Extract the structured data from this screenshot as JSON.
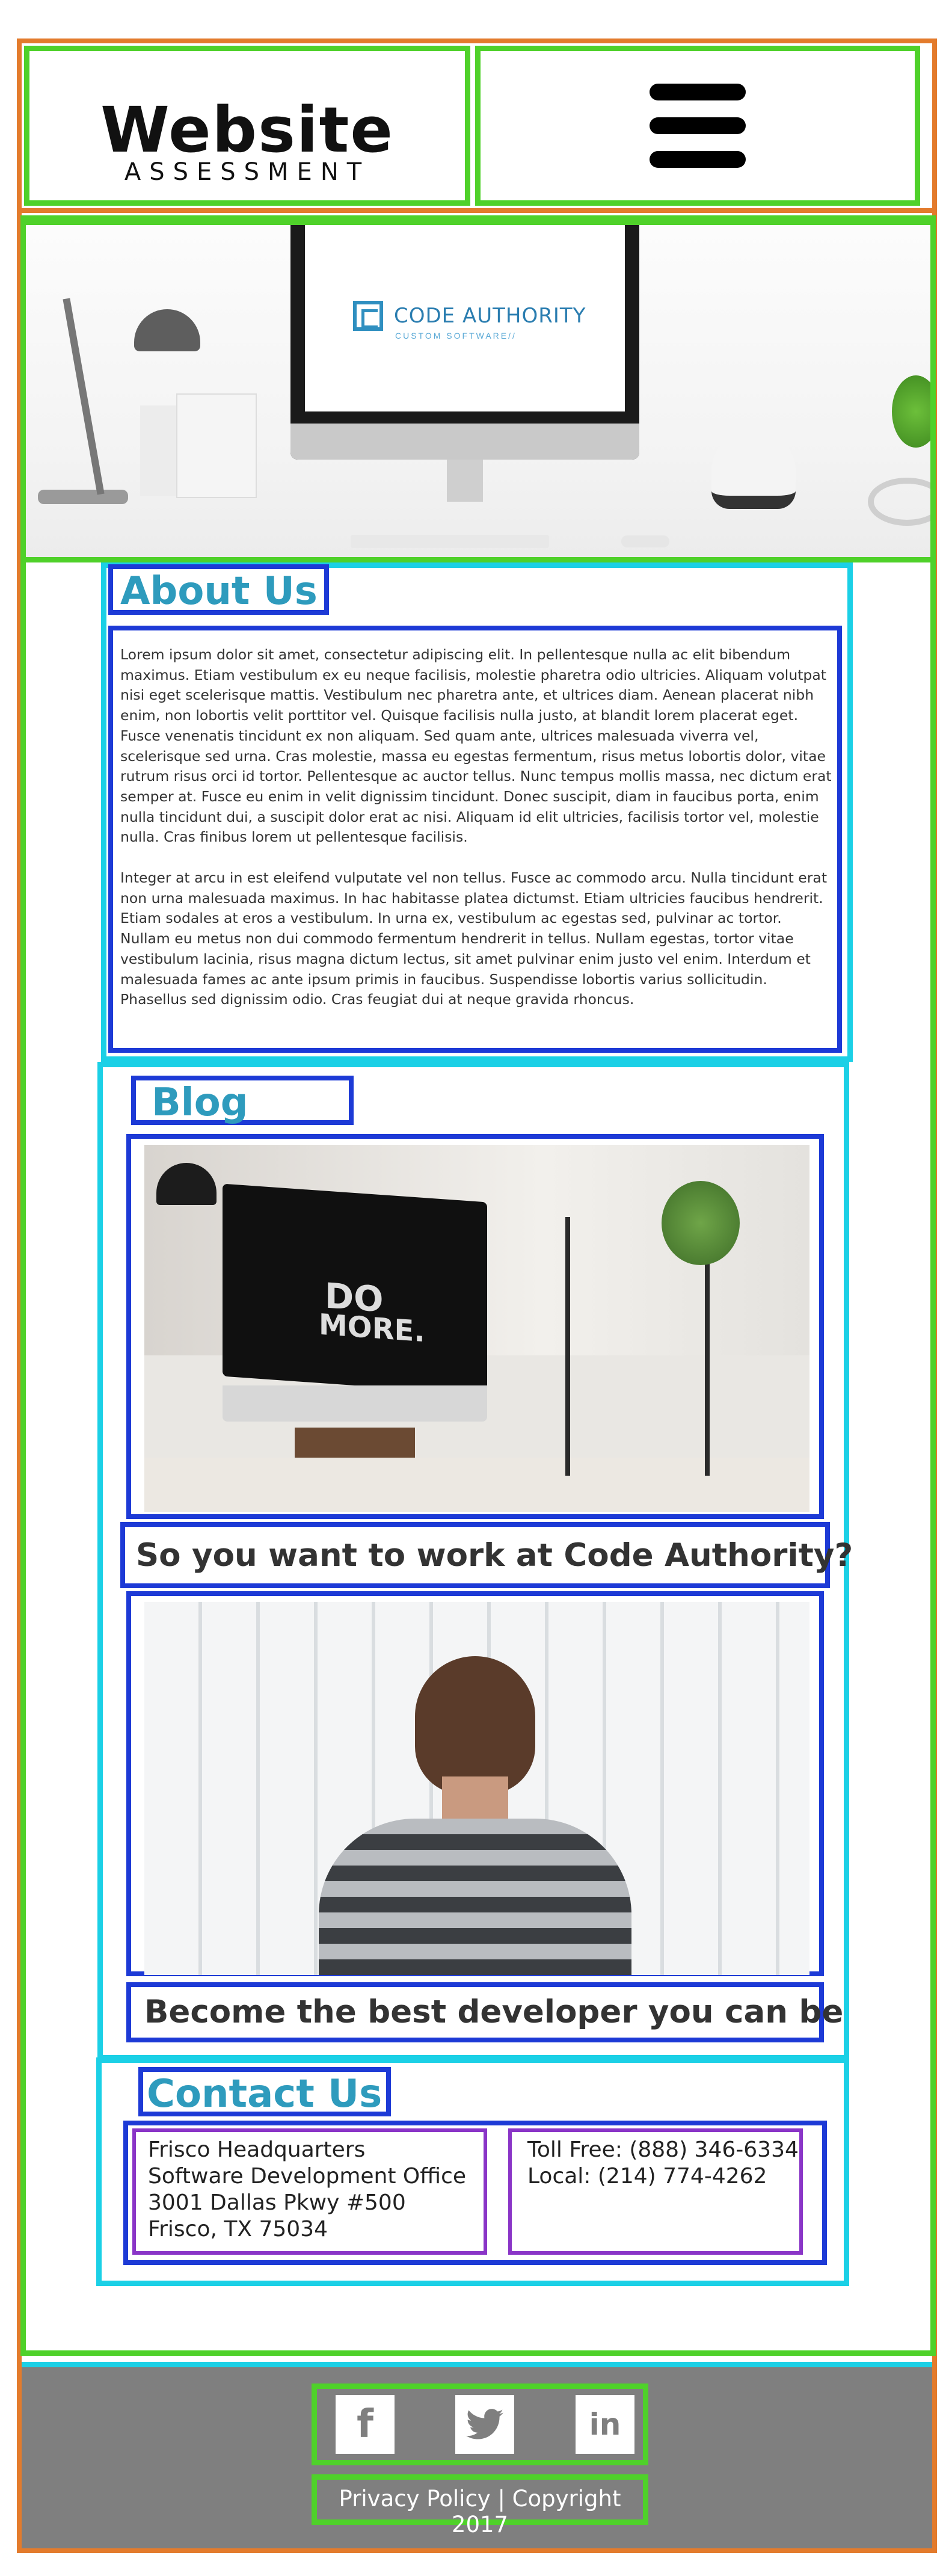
{
  "header": {
    "logo_main": "Website",
    "logo_sub": "ASSESSMENT"
  },
  "hero": {
    "brand_name": "CODE AUTHORITY",
    "brand_tagline": "CUSTOM SOFTWARE//"
  },
  "about": {
    "heading": "About Us",
    "paragraph1": "Lorem ipsum dolor sit amet, consectetur adipiscing elit. In pellentesque nulla ac elit bibendum maximus. Etiam vestibulum ex eu neque facilisis, molestie pharetra odio ultricies. Aliquam volutpat nisi eget scelerisque mattis. Vestibulum nec pharetra ante, et ultrices diam. Aenean placerat nibh enim, non lobortis velit porttitor vel. Quisque facilisis nulla justo, at blandit lorem placerat eget. Fusce venenatis tincidunt ex non aliquam. Sed quam ante, ultrices malesuada viverra vel, scelerisque sed urna. Cras molestie, massa eu egestas fermentum, risus metus lobortis dolor, vitae rutrum risus orci id tortor. Pellentesque ac auctor tellus. Nunc tempus mollis massa, nec dictum erat semper at. Fusce eu enim in velit dignissim tincidunt. Donec suscipit, diam in faucibus porta, enim nulla tincidunt dui, a suscipit dolor erat ac nisi. Aliquam id elit ultricies, facilisis tortor vel, molestie nulla. Cras finibus lorem ut pellentesque facilisis.",
    "paragraph2": "Integer at arcu in est eleifend vulputate vel non tellus. Fusce ac commodo arcu. Nulla tincidunt erat non urna malesuada maximus. In hac habitasse platea dictumst. Etiam ultricies faucibus hendrerit. Etiam sodales at eros a vestibulum. In urna ex, vestibulum ac egestas sed, pulvinar ac tortor. Nullam eu metus non dui commodo fermentum hendrerit in tellus. Nullam egestas, tortor vitae vestibulum lacinia, risus magna dictum lectus, sit amet pulvinar enim justo vel enim. Interdum et malesuada fames ac ante ipsum primis in faucibus. Suspendisse lobortis varius sollicitudin. Phasellus sed dignissim odio. Cras feugiat dui at neque gravida rhoncus."
  },
  "blog": {
    "heading": "Blog",
    "posts": [
      {
        "title": "So you want to work at Code Authority?",
        "image_text_1": "DO",
        "image_text_2": "MORE."
      },
      {
        "title": "Become the best developer you can be"
      }
    ]
  },
  "contact": {
    "heading": "Contact Us",
    "address": [
      "Frisco Headquarters",
      "Software Development Office",
      "3001 Dallas Pkwy #500",
      "Frisco, TX 75034"
    ],
    "phones": [
      "Toll Free: (888) 346-6334",
      "Local: (214) 774-4262"
    ]
  },
  "footer": {
    "social": [
      {
        "icon": "facebook-icon",
        "glyph": "f"
      },
      {
        "icon": "twitter-icon",
        "glyph": "🐦"
      },
      {
        "icon": "linkedin-icon",
        "glyph": "in"
      }
    ],
    "legal": "Privacy Policy | Copyright 2017"
  },
  "colors": {
    "outline_orange": "#e37b2c",
    "outline_green": "#4fd12a",
    "outline_cyan": "#1bd0e6",
    "outline_blue": "#1d3ad6",
    "outline_purple": "#8a35c7",
    "heading_teal": "#2e9bbd",
    "footer_gray": "#7f7f7f"
  }
}
